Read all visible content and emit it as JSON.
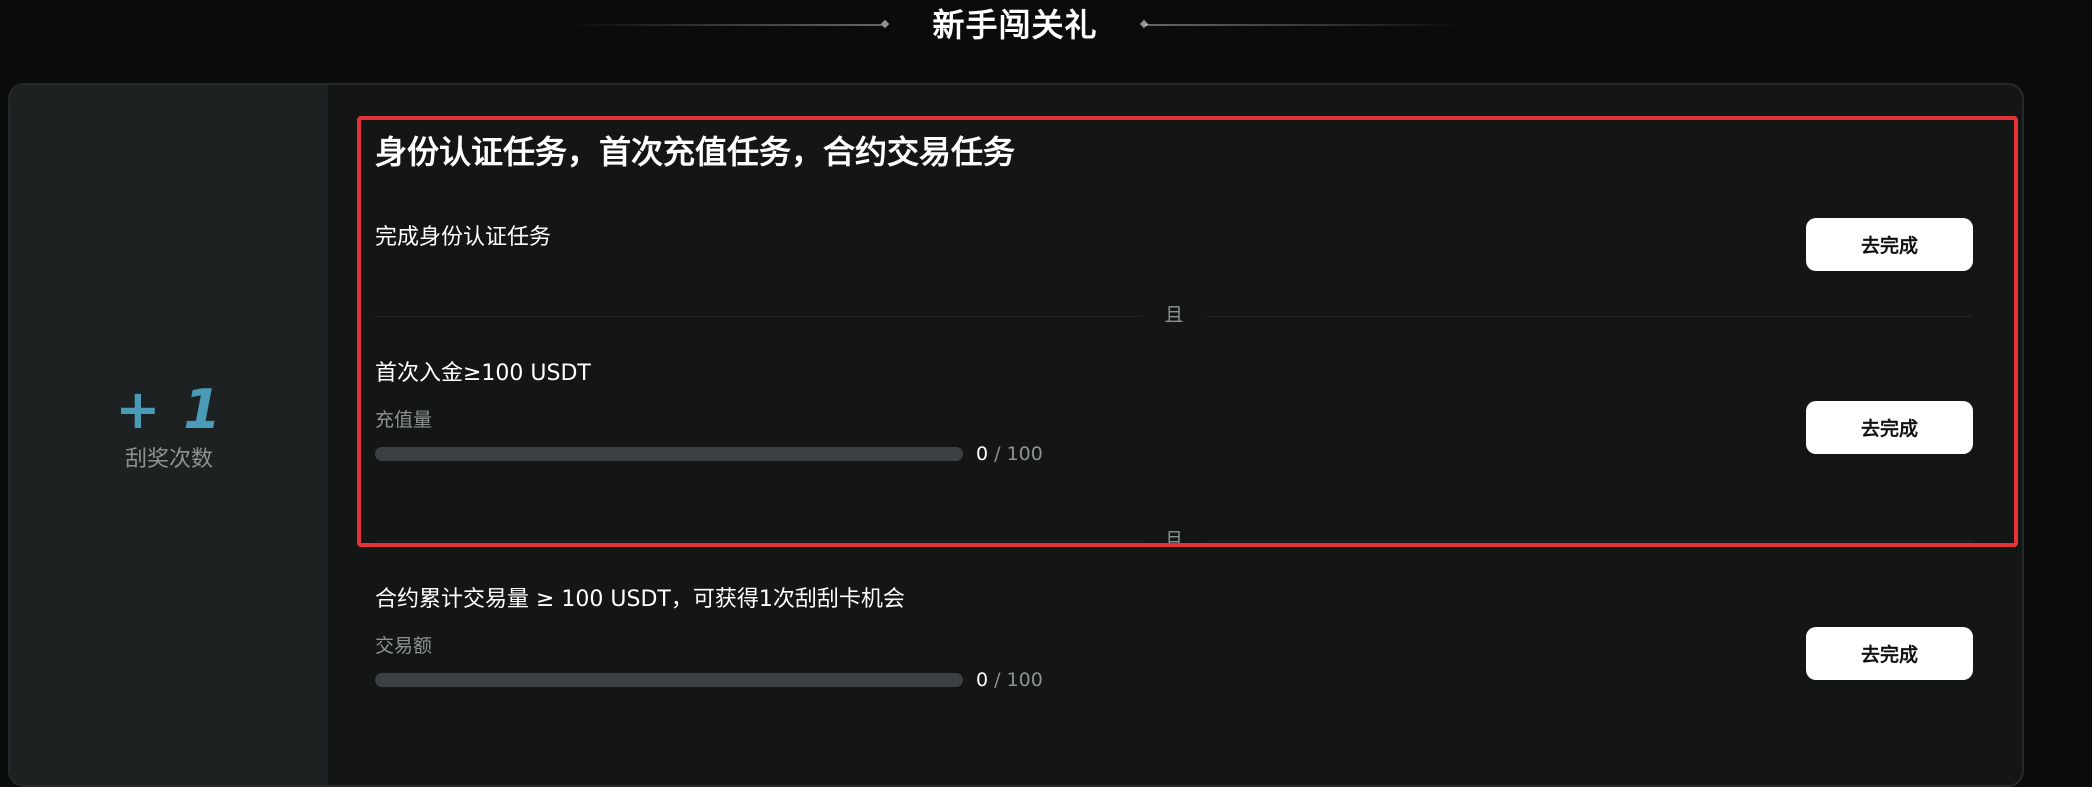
{
  "header": {
    "title": "新手闯关礼"
  },
  "reward": {
    "count": "+ 1",
    "label": "刮奖次数"
  },
  "section": {
    "title": "身份认证任务，首次充值任务，合约交易任务"
  },
  "tasks": [
    {
      "title": "完成身份认证任务",
      "button_label": "去完成"
    },
    {
      "title": "首次入金≥100 USDT",
      "progress_label": "充值量",
      "progress_current": "0",
      "progress_total": "100",
      "progress_fraction": 0,
      "button_label": "去完成"
    },
    {
      "title": "合约累计交易量 ≥ 100 USDT，可获得1次刮刮卡机会",
      "progress_label": "交易额",
      "progress_current": "0",
      "progress_total": "100",
      "progress_fraction": 0,
      "button_label": "去完成"
    }
  ],
  "dividers": [
    {
      "label": "且"
    },
    {
      "label": "且"
    }
  ],
  "colors": {
    "accent": "#4a9bb8",
    "highlight": "#e53238",
    "button_bg": "#ffffff",
    "track": "#3c3f43"
  }
}
